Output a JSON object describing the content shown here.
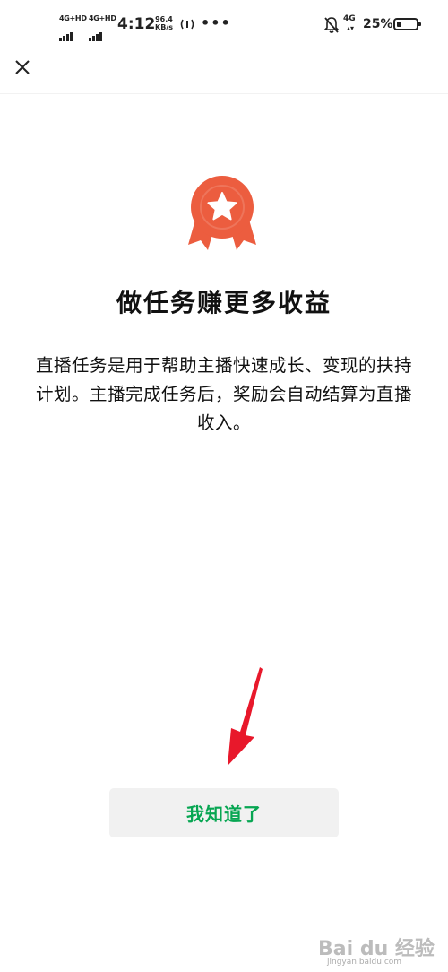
{
  "status_bar": {
    "network_1": "4G+HD",
    "network_2": "4G+HD",
    "time": "4:12",
    "speed_value": "96.4",
    "speed_unit": "KB/s",
    "more": "•••",
    "network_right": "4G",
    "battery_percent": "25%",
    "battery_level": 0.25
  },
  "dialog": {
    "title": "做任务赚更多收益",
    "description": "直播任务是用于帮助主播快速成长、变现的扶持计划。主播完成任务后，奖励会自动结算为直播收入。",
    "confirm_label": "我知道了",
    "accent_color": "#ec5d3f",
    "button_text_color": "#07a652"
  },
  "watermark": {
    "logo": "Bai du 经验",
    "url": "jingyan.baidu.com"
  }
}
